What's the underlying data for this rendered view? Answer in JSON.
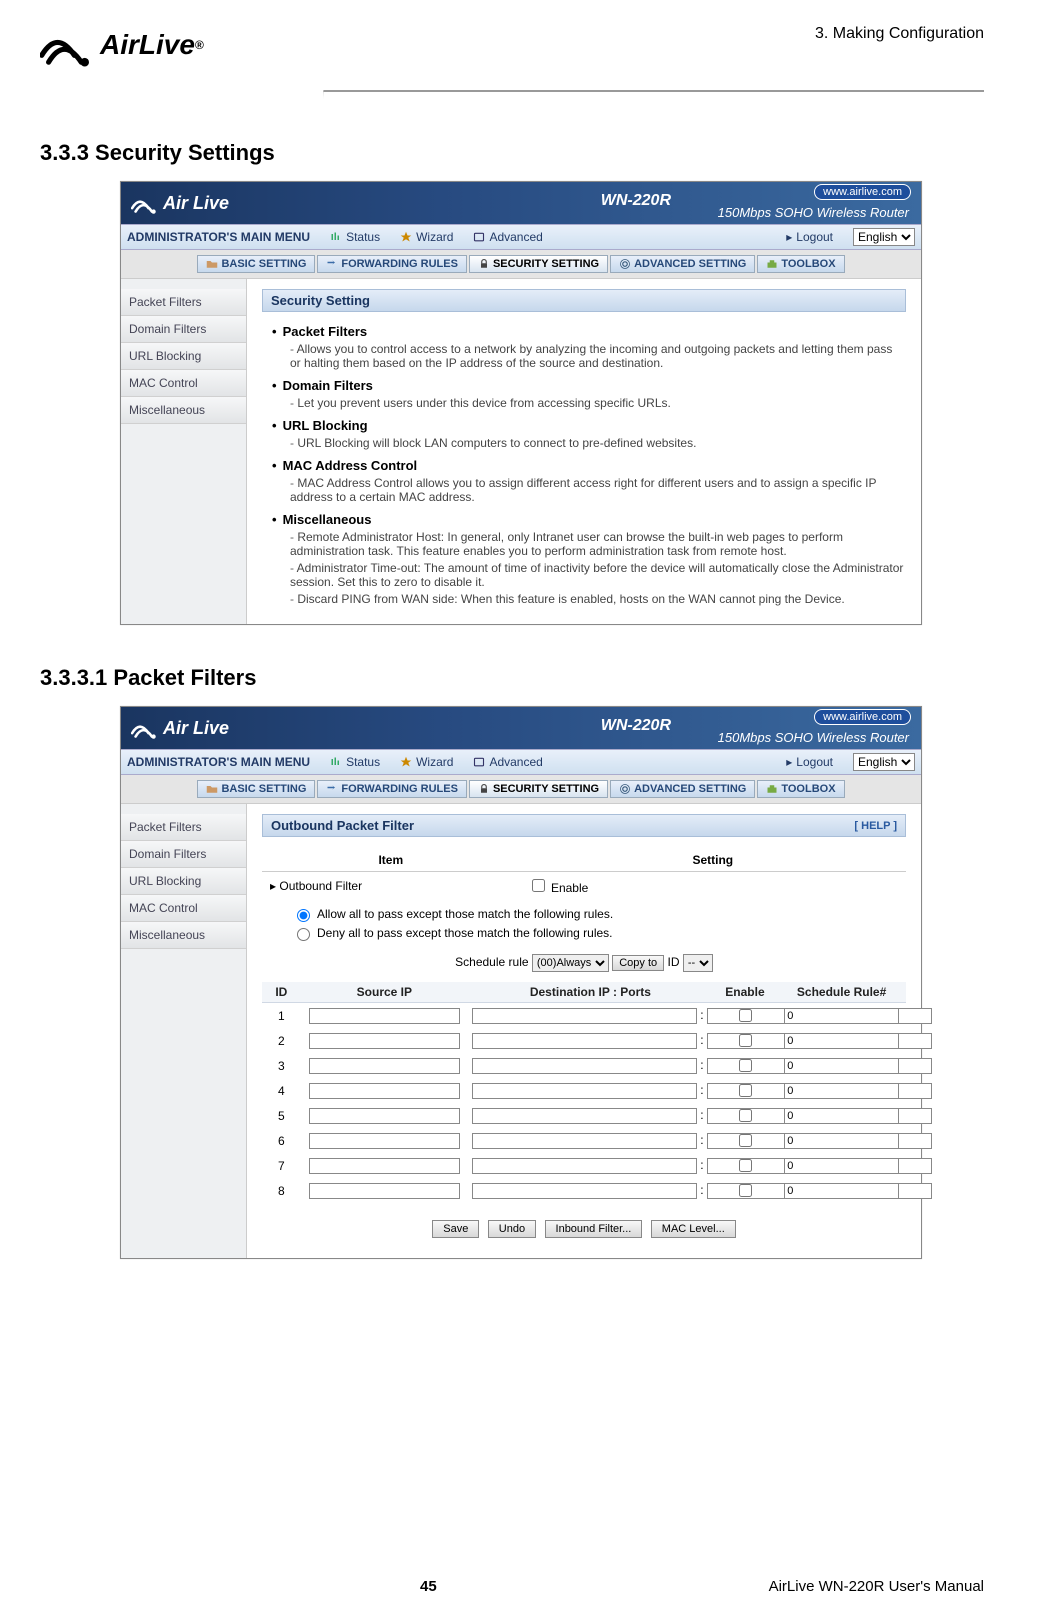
{
  "page_header": {
    "breadcrumb": "3. Making Configuration",
    "logo_text": "AirLive",
    "logo_reg": "®"
  },
  "section1": {
    "title": "3.3.3 Security Settings"
  },
  "section2": {
    "title": "3.3.3.1  Packet Filters"
  },
  "router_common": {
    "url_badge": "www.airlive.com",
    "model": "WN-220R",
    "desc": "150Mbps SOHO Wireless Router",
    "logo_text": "Air Live",
    "admin_label": "ADMINISTRATOR's MAIN MENU",
    "menu1": {
      "status": "Status",
      "wizard": "Wizard",
      "advanced": "Advanced",
      "logout": "Logout"
    },
    "lang_options": [
      "English"
    ],
    "menu2": {
      "basic": "BASIC SETTING",
      "forwarding": "FORWARDING RULES",
      "security": "SECURITY SETTING",
      "advanced": "ADVANCED SETTING",
      "toolbox": "TOOLBOX"
    },
    "sidebar": [
      "Packet Filters",
      "Domain Filters",
      "URL Blocking",
      "MAC Control",
      "Miscellaneous"
    ]
  },
  "shot1": {
    "panel_title": "Security Setting",
    "items": [
      {
        "head": "Packet Filters",
        "subs": [
          "Allows you to control access to a network by analyzing the incoming and outgoing packets and letting them pass or halting them based on the IP address of the source and destination."
        ]
      },
      {
        "head": "Domain Filters",
        "subs": [
          "Let you prevent users under this device from accessing specific URLs."
        ]
      },
      {
        "head": "URL Blocking",
        "subs": [
          "URL Blocking will block LAN computers to connect to pre-defined websites."
        ]
      },
      {
        "head": "MAC Address Control",
        "subs": [
          "MAC Address Control allows you to assign different access right for different users and to assign a specific IP address to a certain MAC address."
        ]
      },
      {
        "head": "Miscellaneous",
        "subs": [
          "Remote Administrator Host: In general, only Intranet user can browse the built-in web pages to perform administration task. This feature enables you to perform administration task from remote host.",
          "Administrator Time-out: The amount of time of inactivity before the device will automatically close the Administrator session. Set this to zero to disable it.",
          "Discard PING from WAN side: When this feature is enabled, hosts on the WAN cannot ping the Device."
        ]
      }
    ]
  },
  "shot2": {
    "panel_title": "Outbound Packet Filter",
    "help_label": "[ HELP ]",
    "top_table": {
      "head_item": "Item",
      "head_setting": "Setting",
      "outbound_label": "Outbound Filter",
      "enable_label": "Enable"
    },
    "radios": {
      "allow": "Allow all to pass except those match the following rules.",
      "deny": "Deny all to pass except those match the following rules."
    },
    "schedule": {
      "label_left": "Schedule rule",
      "option": "(00)Always",
      "copy_btn": "Copy to",
      "id_label": "ID",
      "id_option": "--"
    },
    "columns": {
      "id": "ID",
      "src": "Source IP",
      "dst": "Destination IP : Ports",
      "enable": "Enable",
      "sched": "Schedule Rule#"
    },
    "rows": [
      {
        "id": "1",
        "sched": "0"
      },
      {
        "id": "2",
        "sched": "0"
      },
      {
        "id": "3",
        "sched": "0"
      },
      {
        "id": "4",
        "sched": "0"
      },
      {
        "id": "5",
        "sched": "0"
      },
      {
        "id": "6",
        "sched": "0"
      },
      {
        "id": "7",
        "sched": "0"
      },
      {
        "id": "8",
        "sched": "0"
      }
    ],
    "buttons": {
      "save": "Save",
      "undo": "Undo",
      "inbound": "Inbound Filter...",
      "mac": "MAC Level..."
    }
  },
  "footer": {
    "page_number": "45",
    "manual_title": "AirLive WN-220R User's Manual"
  }
}
